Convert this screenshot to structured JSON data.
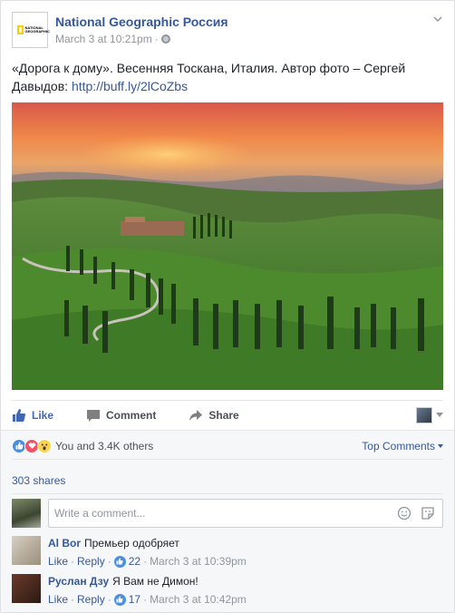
{
  "post": {
    "page_name": "National Geographic Россия",
    "timestamp": "March 3 at 10:21pm",
    "separator": "·",
    "logo_text": "NATIONAL GEOGRAPHIC",
    "text": "«Дорога к дому». Весенняя Тоскана, Италия. Автор фото – Сергей Давыдов: ",
    "link": "http://buff.ly/2lCoZbs"
  },
  "actions": {
    "like": "Like",
    "comment": "Comment",
    "share": "Share"
  },
  "reactions": {
    "summary": "You and 3.4K others",
    "sort_label": "Top Comments"
  },
  "shares": "303 shares",
  "compose": {
    "placeholder": "Write a comment..."
  },
  "comments": [
    {
      "author": "Al Bor",
      "text": "Премьер одобряет",
      "like": "Like",
      "reply": "Reply",
      "dot": "·",
      "likes": "22",
      "time": "March 3 at 10:39pm"
    },
    {
      "author": "Руслан Дзу",
      "text": "Я Вам не Димон!",
      "like": "Like",
      "reply": "Reply",
      "dot": "·",
      "likes": "17",
      "time": "March 3 at 10:42pm"
    }
  ],
  "colors": {
    "link": "#365899",
    "like_blue": "#4267b2",
    "muted": "#90949c"
  }
}
